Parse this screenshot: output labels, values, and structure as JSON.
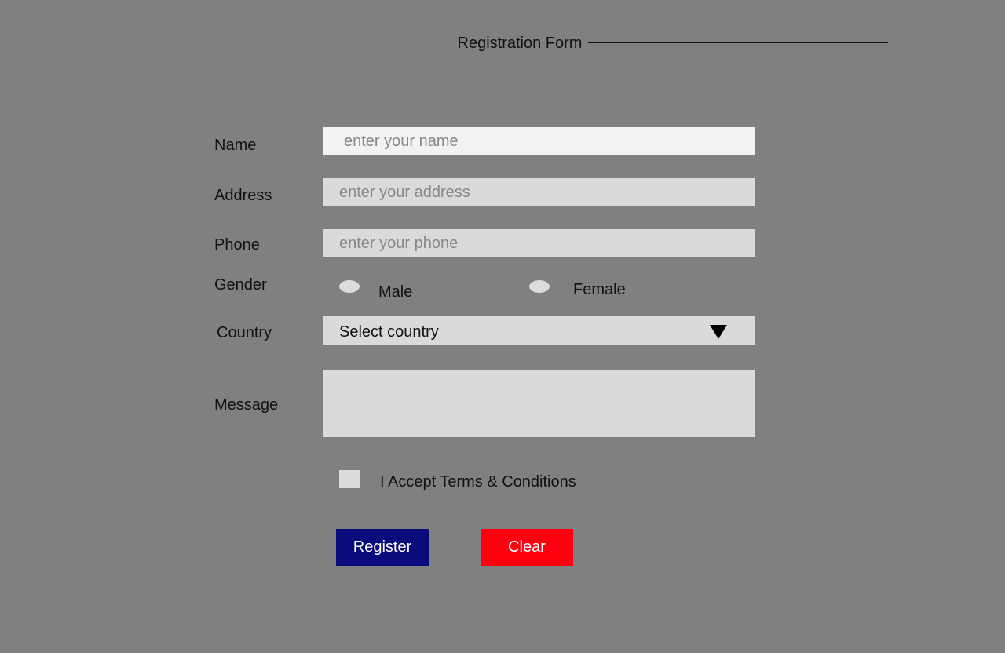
{
  "form": {
    "title": "Registration Form"
  },
  "fields": {
    "name": {
      "label": "Name",
      "placeholder": "enter your name",
      "value": ""
    },
    "address": {
      "label": "Address",
      "placeholder": "enter your address",
      "value": ""
    },
    "phone": {
      "label": "Phone",
      "placeholder": "enter your phone",
      "value": ""
    },
    "gender": {
      "label": "Gender",
      "options": [
        "Male",
        "Female"
      ]
    },
    "country": {
      "label": "Country",
      "selected": "Select country"
    },
    "message": {
      "label": "Message",
      "value": ""
    }
  },
  "terms": {
    "label": "I Accept Terms & Conditions"
  },
  "buttons": {
    "register": {
      "label": "Register"
    },
    "clear": {
      "label": "Clear"
    }
  },
  "colors": {
    "background": "#808080",
    "register_button": "#0a0a7d",
    "clear_button": "#ff0010",
    "field_background": "#dadada",
    "name_field_background": "#f2f2f2"
  },
  "icons": {
    "country_dropdown": "triangle-down-icon"
  }
}
